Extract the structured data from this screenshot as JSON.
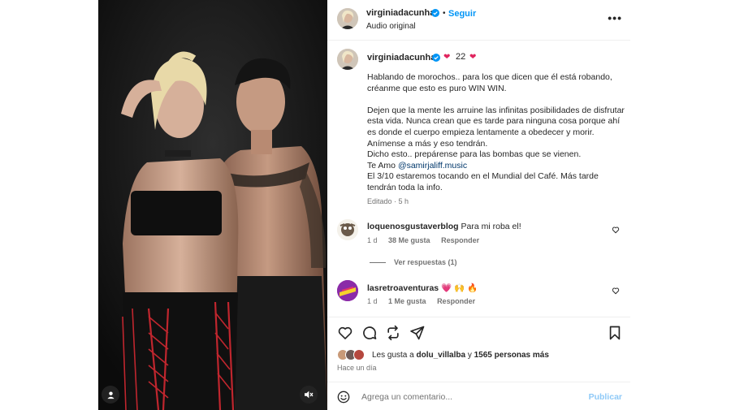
{
  "post": {
    "username": "virginiadacunha",
    "follow_label": "Seguir",
    "separator": "•",
    "audio": "Audio original",
    "more": "•••"
  },
  "caption": {
    "username": "virginiadacunha",
    "heart_emoji": "❤",
    "heart_count": "22",
    "text_before_mention": "Hablando de morochos.. para los que dicen que él está robando, créanme que esto es puro WIN WIN.\n\nDejen que la mente les arruine las infinitas posibilidades de disfrutar esta vida. Nunca crean que es tarde para ninguna cosa porque ahí es donde el cuerpo empieza lentamente a obedecer y morir. Anímense a más y eso tendrán.\nDicho esto.. prepárense para las bombas que se vienen.\nTe Amo ",
    "mention": "@samirjaliff.music",
    "text_after_mention": "\nEl 3/10 estaremos tocando en el Mundial del Café. Más tarde tendrán toda la info.",
    "edited": "Editado · 5 h"
  },
  "comments": [
    {
      "username": "loquenosgustaverblog",
      "text": "Para mi roba el!",
      "age": "1 d",
      "likes": "38 Me gusta",
      "reply": "Responder"
    },
    {
      "username": "lasretroaventuras",
      "text": "💗 🙌 🔥",
      "age": "1 d",
      "likes": "1 Me gusta",
      "reply": "Responder"
    }
  ],
  "view_replies": "Ver respuestas (1)",
  "likes": {
    "prefix": "Les gusta a ",
    "user": "dolu_villalba",
    "middle": " y ",
    "others": "1565 personas más"
  },
  "time_ago": "Hace un día",
  "add_comment": {
    "placeholder": "Agrega un comentario...",
    "publish": "Publicar"
  },
  "colors": {
    "accent": "#0095f6",
    "publish_disabled": "#8ec9f7",
    "verified": "#0095f6",
    "heart": "#e0245e",
    "media_bg": "#121212"
  },
  "icons": [
    "heart-icon",
    "comment-icon",
    "repost-icon",
    "share-icon",
    "bookmark-icon",
    "emoji-icon",
    "verified-icon",
    "tags-icon",
    "audio-muted-icon",
    "more-options-icon"
  ]
}
